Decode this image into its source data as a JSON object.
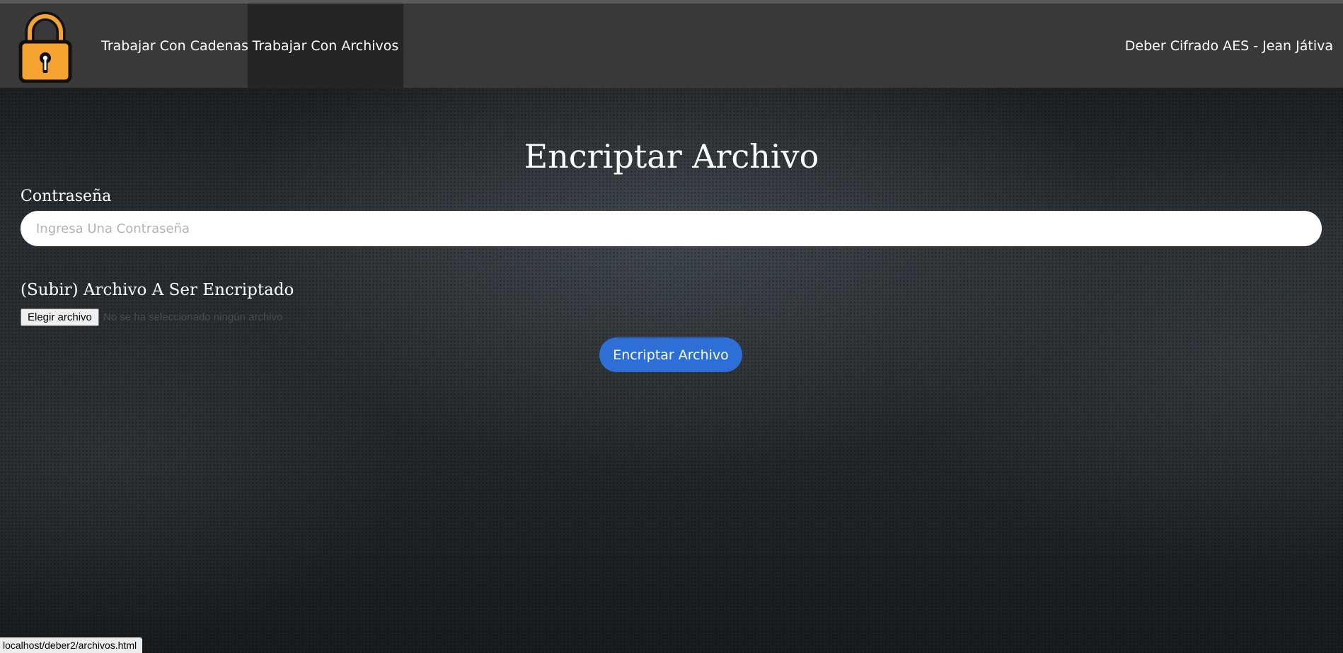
{
  "navbar": {
    "brand_icon": "padlock-icon",
    "links": [
      {
        "label": "Trabajar Con Cadenas",
        "active": false
      },
      {
        "label": "Trabajar Con Archivos",
        "active": true
      }
    ],
    "right_text": "Deber Cifrado AES - Jean Játiva",
    "colors": {
      "background": "#393939",
      "active_background": "#252525",
      "lock_body": "#f4a230"
    }
  },
  "main": {
    "title": "Encriptar Archivo",
    "password": {
      "label": "Contraseña",
      "placeholder": "Ingresa Una Contraseña",
      "value": ""
    },
    "file_upload": {
      "label": "(Subir) Archivo A Ser Encriptado",
      "button_label": "Elegir archivo",
      "status_text": "No se ha seleccionado ningún archivo"
    },
    "submit_label": "Encriptar Archivo",
    "colors": {
      "submit_button": "#2d6fd6"
    }
  },
  "status_bar": {
    "url": "localhost/deber2/archivos.html"
  }
}
